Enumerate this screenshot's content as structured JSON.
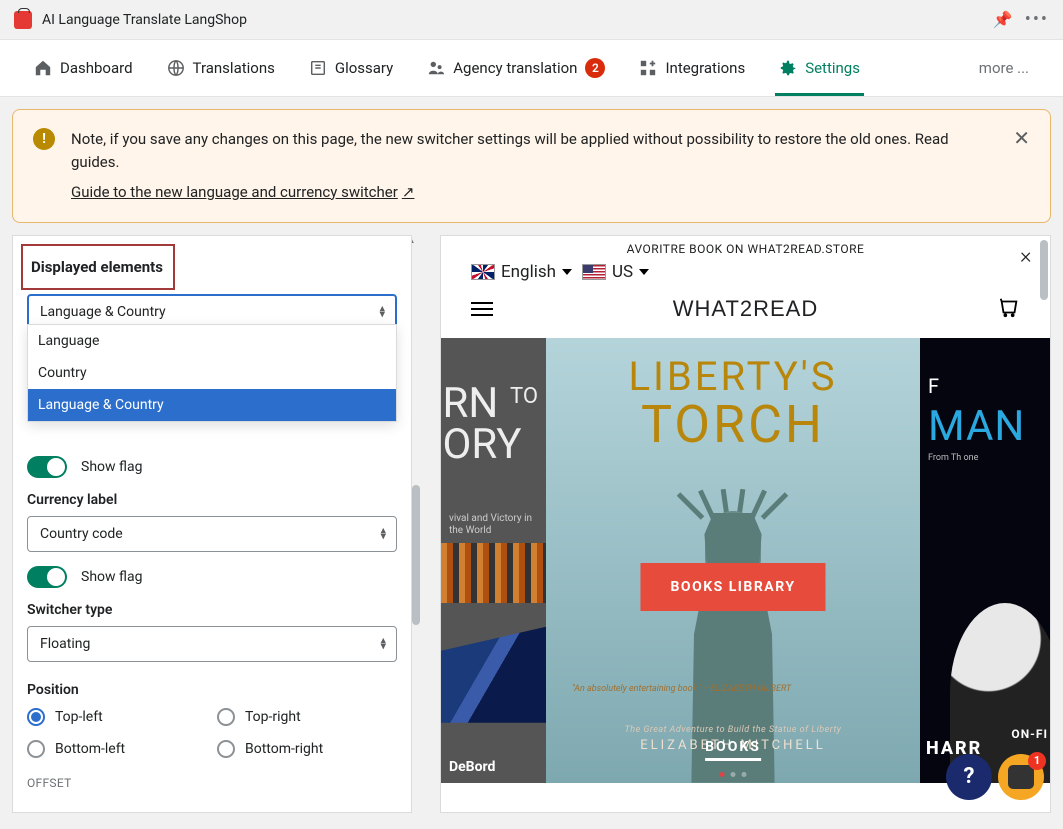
{
  "app": {
    "title": "AI Language Translate LangShop"
  },
  "tabs": {
    "dashboard": "Dashboard",
    "translations": "Translations",
    "glossary": "Glossary",
    "agency": "Agency translation",
    "agency_badge": "2",
    "integrations": "Integrations",
    "settings": "Settings",
    "more": "more ..."
  },
  "alert": {
    "text": "Note, if you save any changes on this page, the new switcher settings will be applied without possibility to restore the old ones. Read guides.",
    "link": "Guide to the new language and currency switcher"
  },
  "sidebar": {
    "section_title": "Displayed elements",
    "displayed_select_value": "Language & Country",
    "displayed_options": {
      "opt0": "Language",
      "opt1": "Country",
      "opt2": "Language & Country"
    },
    "show_flag_1": "Show flag",
    "currency_label": "Currency label",
    "currency_select_value": "Country code",
    "show_flag_2": "Show flag",
    "switcher_type_label": "Switcher type",
    "switcher_type_value": "Floating",
    "position_label": "Position",
    "positions": {
      "tl": "Top-left",
      "tr": "Top-right",
      "bl": "Bottom-left",
      "br": "Bottom-right"
    },
    "offset_label": "OFFSET"
  },
  "preview": {
    "top_banner": "AVORITRE BOOK ON WHAT2READ.STORE",
    "lang_label": "English",
    "country_label": "US",
    "brand": "WHAT2READ",
    "hero_left_line1": "RN",
    "hero_left_line2": "TO",
    "hero_left_line3": "ORY",
    "hero_left_sub": "vival and Victory\nin the World",
    "hero_left_author": "DeBord",
    "hero_center_title1": "LIBERTY'S",
    "hero_center_title2": "TORCH",
    "hero_center_quote": "\"An absolutely\nentertaining book.\"\n—ELIZABETH GILBERT",
    "hero_center_tag": "The Great Adventure to Build\nthe Statue of Liberty",
    "hero_center_author": "ELIZABETH MITCHELL",
    "cta": "BOOKS LIBRARY",
    "category": "BOOKS",
    "hero_right_for": "F",
    "hero_right_title": "MAN",
    "hero_right_sub": "From Th\none",
    "hero_right_author": "HARR",
    "hero_right_tag": "ON-FI",
    "help": "?",
    "chat_badge": "1"
  }
}
